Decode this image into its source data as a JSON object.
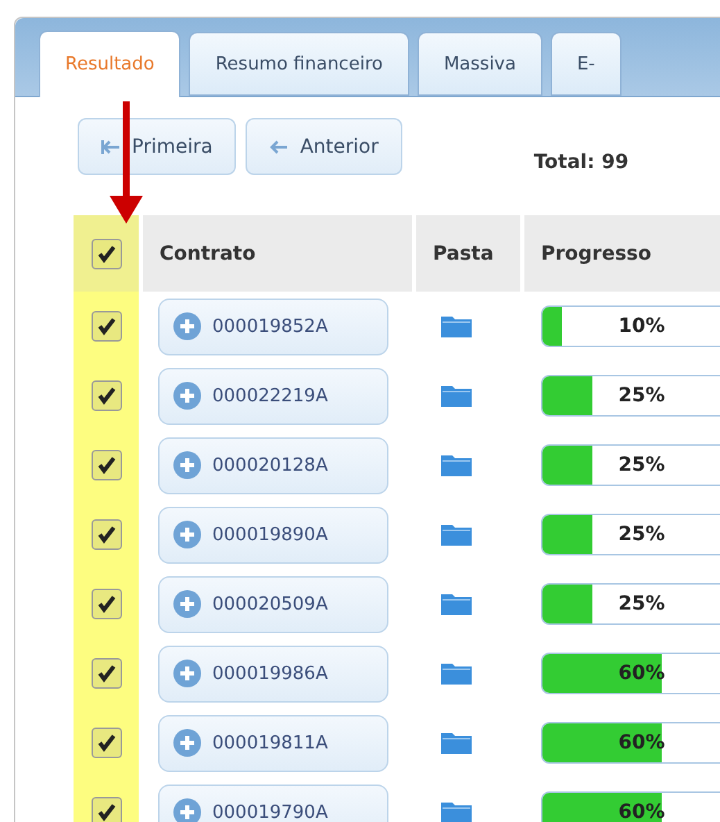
{
  "tabs": [
    {
      "label": "Resultado",
      "selected": true
    },
    {
      "label": "Resumo financeiro",
      "selected": false
    },
    {
      "label": "Massiva",
      "selected": false
    },
    {
      "label": "E-",
      "selected": false
    }
  ],
  "pager": {
    "buttons": [
      "Primeira",
      "Anterior"
    ],
    "total": "Total: 99"
  },
  "table": {
    "select_all": {
      "checked": true
    },
    "columns": [
      "Contrato",
      "Pasta",
      "Progresso"
    ],
    "rows": [
      {
        "checked": true,
        "contract": "000019852A",
        "progress_label": "10%",
        "level": 0.1
      },
      {
        "checked": true,
        "contract": "000022219A",
        "progress_label": "25%",
        "level": 0.25
      },
      {
        "checked": true,
        "contract": "000020128A",
        "progress_label": "25%",
        "level": 0.25
      },
      {
        "checked": true,
        "contract": "000019890A",
        "progress_label": "25%",
        "level": 0.25
      },
      {
        "checked": true,
        "contract": "000020509A",
        "progress_label": "25%",
        "level": 0.25
      },
      {
        "checked": true,
        "contract": "000019986A",
        "progress_label": "60%",
        "level": 0.6
      },
      {
        "checked": true,
        "contract": "000019811A",
        "progress_label": "60%",
        "level": 0.6
      },
      {
        "checked": true,
        "contract": "000019790A",
        "progress_label": "60%",
        "level": 0.6
      }
    ]
  }
}
